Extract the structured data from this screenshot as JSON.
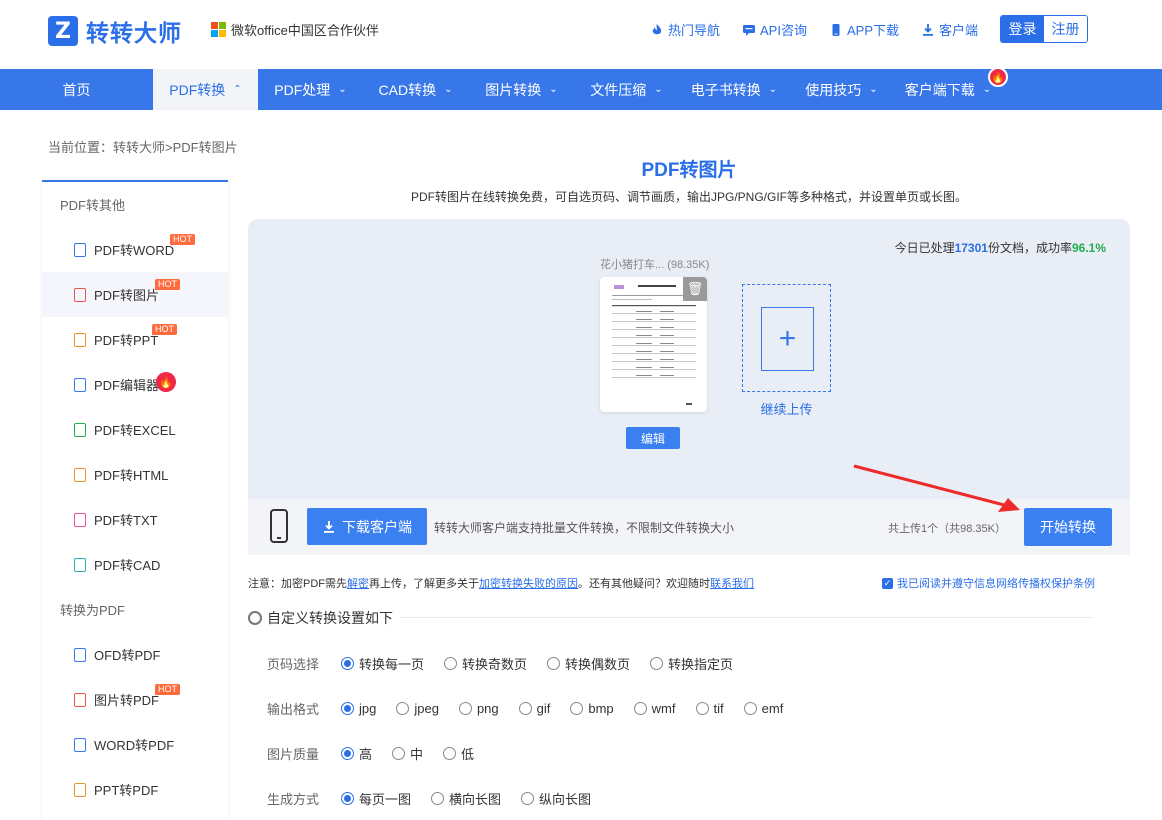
{
  "brand": {
    "logo_letter": "Z",
    "name": "转转大师",
    "partner": "微软office中国区合作伙伴"
  },
  "top_links": [
    {
      "label": "热门导航",
      "icon": "flame-icon"
    },
    {
      "label": "API咨询",
      "icon": "chat-icon"
    },
    {
      "label": "APP下载",
      "icon": "phone-icon"
    },
    {
      "label": "客户端",
      "icon": "download-icon"
    }
  ],
  "auth": {
    "login": "登录",
    "register": "注册"
  },
  "nav": [
    {
      "label": "首页",
      "chev": ""
    },
    {
      "label": "PDF转换",
      "chev": "⌃"
    },
    {
      "label": "PDF处理",
      "chev": "⌄"
    },
    {
      "label": "CAD转换",
      "chev": "⌄"
    },
    {
      "label": "图片转换",
      "chev": "⌄"
    },
    {
      "label": "文件压缩",
      "chev": "⌄"
    },
    {
      "label": "电子书转换",
      "chev": "⌄"
    },
    {
      "label": "使用技巧",
      "chev": "⌄"
    },
    {
      "label": "客户端下载",
      "chev": "⌄"
    }
  ],
  "breadcrumb": "当前位置：转转大师>PDF转图片",
  "sidebar": {
    "group1": "PDF转其他",
    "items1": [
      {
        "label": "PDF转WORD",
        "badge": "HOT",
        "color": "#3877ea"
      },
      {
        "label": "PDF转图片",
        "badge": "HOT",
        "color": "#e8574a"
      },
      {
        "label": "PDF转PPT",
        "badge": "HOT",
        "color": "#f0922a"
      },
      {
        "label": "PDF编辑器",
        "badge": "",
        "color": "#3877ea"
      },
      {
        "label": "PDF转EXCEL",
        "badge": "",
        "color": "#1fae4f"
      },
      {
        "label": "PDF转HTML",
        "badge": "",
        "color": "#f0922a"
      },
      {
        "label": "PDF转TXT",
        "badge": "",
        "color": "#e0559b"
      },
      {
        "label": "PDF转CAD",
        "badge": "",
        "color": "#20b3a8"
      }
    ],
    "group2": "转换为PDF",
    "items2": [
      {
        "label": "OFD转PDF",
        "badge": "",
        "color": "#3877ea"
      },
      {
        "label": "图片转PDF",
        "badge": "HOT",
        "color": "#e8574a"
      },
      {
        "label": "WORD转PDF",
        "badge": "",
        "color": "#3877ea"
      },
      {
        "label": "PPT转PDF",
        "badge": "",
        "color": "#f0922a"
      }
    ]
  },
  "page": {
    "title": "PDF转图片",
    "subtitle": "PDF转图片在线转换免费，可自选页码、调节画质，输出JPG/PNG/GIF等多种格式，并设置单页或长图。"
  },
  "upload": {
    "stats_prefix": "今日已处理",
    "stats_count": "17301",
    "stats_mid": "份文档，成功率",
    "stats_rate": "96.1%",
    "file_name": "花小猪打车... (98.35K)",
    "edit_label": "编辑",
    "continue_label": "继续上传"
  },
  "bottombar": {
    "download_label": "下载客户端",
    "download_note": "转转大师客户端支持批量文件转换，不限制文件转换大小",
    "total": "共上传1个（共98.35K）",
    "start_label": "开始转换"
  },
  "notice": {
    "p1": "注意：加密PDF需先",
    "link1": "解密",
    "p2": "再上传，了解更多关于",
    "link2": "加密转换失败的原因",
    "p3": "。还有其他疑问？欢迎随时",
    "link3": "联系我们"
  },
  "agree": "我已阅读并遵守信息网络传播权保护条例",
  "settings_title": "自定义转换设置如下",
  "options": [
    {
      "label": "页码选择",
      "choices": [
        "转换每一页",
        "转换奇数页",
        "转换偶数页",
        "转换指定页"
      ],
      "selected": 0
    },
    {
      "label": "输出格式",
      "choices": [
        "jpg",
        "jpeg",
        "png",
        "gif",
        "bmp",
        "wmf",
        "tif",
        "emf"
      ],
      "selected": 0
    },
    {
      "label": "图片质量",
      "choices": [
        "高",
        "中",
        "低"
      ],
      "selected": 0
    },
    {
      "label": "生成方式",
      "choices": [
        "每页一图",
        "横向长图",
        "纵向长图"
      ],
      "selected": 0
    }
  ],
  "colors": {
    "primary": "#2a6ee8",
    "nav": "#3877ea",
    "hot": "#ff6b3d",
    "success": "#1fae4f"
  }
}
